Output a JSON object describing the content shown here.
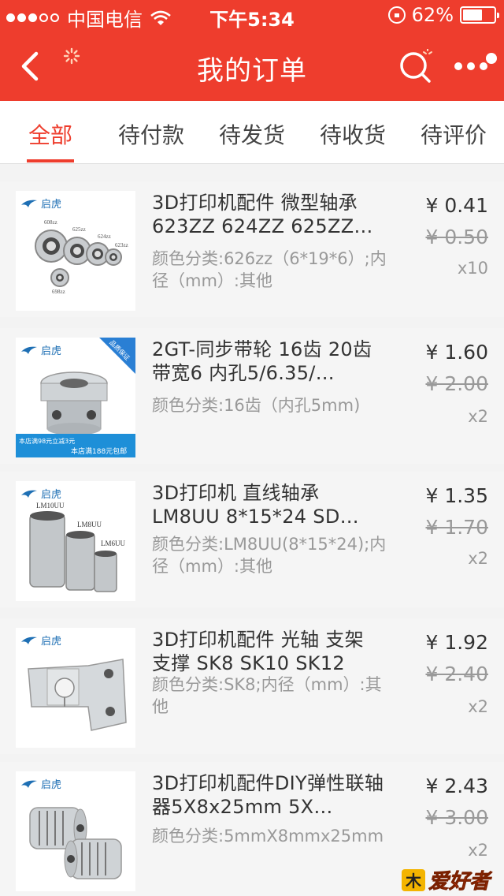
{
  "status_bar": {
    "carrier": "中国电信",
    "time": "下午5:34",
    "battery": "62%",
    "battery_level": 0.62
  },
  "nav": {
    "title": "我的订单"
  },
  "tabs": [
    {
      "label": "全部",
      "active": true
    },
    {
      "label": "待付款",
      "active": false
    },
    {
      "label": "待发货",
      "active": false
    },
    {
      "label": "待收货",
      "active": false
    },
    {
      "label": "待评价",
      "active": false
    }
  ],
  "orders": [
    {
      "title": "3D打印机配件 微型轴承 623ZZ 624ZZ 625ZZ…",
      "variant": "颜色分类:626zz（6*19*6）;内径（mm）:其他",
      "price": "¥ 0.41",
      "original_price": "¥ 0.50",
      "quantity": "x10",
      "brand": "启虎",
      "thumb_labels": [
        "608zz",
        "625zz",
        "624zz",
        "623zz",
        "698zz"
      ]
    },
    {
      "title": "2GT-同步带轮 16齿 20齿 带宽6 内孔5/6.35/…",
      "variant": "颜色分类:16齿（内孔5mm)",
      "price": "¥ 1.60",
      "original_price": "¥ 2.00",
      "quantity": "x2",
      "brand": "启虎",
      "thumb_labels": [
        "品质保证",
        "本店满98元立减3元",
        "本店满188元包邮"
      ]
    },
    {
      "title": "3D打印机 直线轴承 LM8UU 8*15*24 SD…",
      "variant": "颜色分类:LM8UU(8*15*24);内径（mm）:其他",
      "price": "¥ 1.35",
      "original_price": "¥ 1.70",
      "quantity": "x2",
      "brand": "启虎",
      "thumb_labels": [
        "LM10UU",
        "LM8UU",
        "LM6UU"
      ]
    },
    {
      "title": "3D打印机配件 光轴 支架 支撑 SK8 SK10 SK12",
      "variant": "颜色分类:SK8;内径（mm）:其他",
      "price": "¥ 1.92",
      "original_price": "¥ 2.40",
      "quantity": "x2",
      "brand": "启虎",
      "thumb_labels": []
    },
    {
      "title": "3D打印机配件DIY弹性联轴器5X8x25mm 5X…",
      "variant": "颜色分类:5mmX8mmx25mm",
      "price": "¥ 2.43",
      "original_price": "¥ 3.00",
      "quantity": "x2",
      "brand": "启虎",
      "thumb_labels": []
    }
  ],
  "watermark": "爱好者",
  "colors": {
    "accent": "#ee3d2d",
    "brand_blue": "#1e6fb4"
  },
  "icons": [
    "back-arrow-icon",
    "search-icon",
    "more-icon",
    "wifi-icon",
    "lock-icon",
    "battery-icon"
  ]
}
